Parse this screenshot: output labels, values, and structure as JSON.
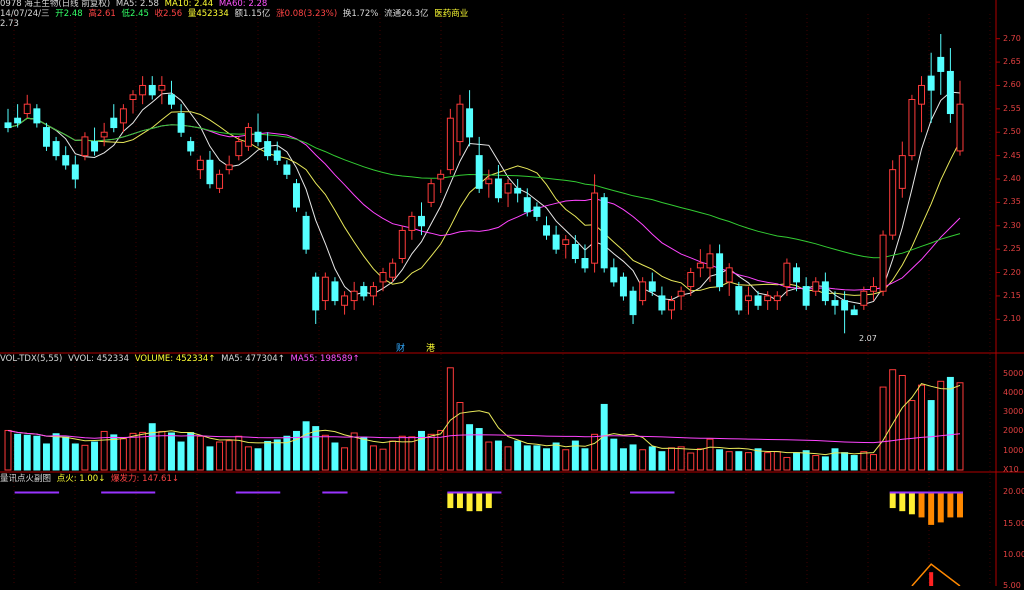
{
  "header": {
    "title": "0978 海王生物(日线 前复权)",
    "ma5": "MA5: 2.58",
    "ma10": "MA10: 2.44",
    "ma60": "MA60: 2.28",
    "date": "14/07/24/三",
    "open": "开2.48",
    "high": "高2.61",
    "low": "低2.45",
    "close": "收2.56",
    "volume": "量452334",
    "amount": "额1.15亿",
    "change": "涨0.08(3.23%)",
    "turnover": "换1.72%",
    "float": "流通26.3亿",
    "industry": "医药商业",
    "top_price": "2.73"
  },
  "panel_labels": {
    "vol": "VOL-TDX(5,55)",
    "vvol": "VVOL: 452334",
    "volume": "VOLUME: 452334↑",
    "ma5": "MA5: 477304↑",
    "ma55": "MA55: 198589↑",
    "ind_name": "量讯点火副图",
    "ind_a": "点火: 1.00↓",
    "ind_b": "爆发力: 147.61↓"
  },
  "markers": {
    "cai": "财",
    "gang": "港",
    "low": "2.07"
  },
  "colors": {
    "up": "#ff3b3b",
    "down": "#55ffff",
    "ma5": "#e8e8e8",
    "ma10": "#e8e85a",
    "ma20": "#ff44ff",
    "ma60": "#33cc33",
    "axis": "#b00000"
  },
  "chart_data": [
    {
      "type": "candlestick",
      "title": "price",
      "ylim": [
        2.06,
        2.74
      ],
      "y_ticks": [
        "2.70",
        "2.65",
        "2.60",
        "2.55",
        "2.50",
        "2.45",
        "2.40",
        "2.35",
        "2.30",
        "2.25",
        "2.20",
        "2.15",
        "2.10"
      ],
      "y_tick_values": [
        2.7,
        2.65,
        2.6,
        2.55,
        2.5,
        2.45,
        2.4,
        2.35,
        2.3,
        2.25,
        2.2,
        2.15,
        2.1
      ],
      "candles": [
        [
          2.52,
          2.55,
          2.5,
          2.51
        ],
        [
          2.53,
          2.56,
          2.51,
          2.52
        ],
        [
          2.54,
          2.58,
          2.53,
          2.56
        ],
        [
          2.55,
          2.56,
          2.51,
          2.52
        ],
        [
          2.51,
          2.52,
          2.46,
          2.47
        ],
        [
          2.48,
          2.49,
          2.44,
          2.45
        ],
        [
          2.45,
          2.47,
          2.42,
          2.43
        ],
        [
          2.43,
          2.45,
          2.38,
          2.4
        ],
        [
          2.45,
          2.5,
          2.44,
          2.49
        ],
        [
          2.48,
          2.51,
          2.45,
          2.46
        ],
        [
          2.49,
          2.52,
          2.47,
          2.5
        ],
        [
          2.53,
          2.56,
          2.5,
          2.51
        ],
        [
          2.52,
          2.56,
          2.5,
          2.55
        ],
        [
          2.57,
          2.59,
          2.54,
          2.58
        ],
        [
          2.58,
          2.62,
          2.56,
          2.6
        ],
        [
          2.6,
          2.62,
          2.57,
          2.58
        ],
        [
          2.59,
          2.62,
          2.56,
          2.6
        ],
        [
          2.58,
          2.61,
          2.55,
          2.56
        ],
        [
          2.54,
          2.56,
          2.49,
          2.5
        ],
        [
          2.48,
          2.49,
          2.45,
          2.46
        ],
        [
          2.42,
          2.45,
          2.4,
          2.44
        ],
        [
          2.44,
          2.46,
          2.38,
          2.39
        ],
        [
          2.38,
          2.42,
          2.37,
          2.41
        ],
        [
          2.42,
          2.45,
          2.41,
          2.43
        ],
        [
          2.45,
          2.49,
          2.44,
          2.48
        ],
        [
          2.47,
          2.52,
          2.46,
          2.51
        ],
        [
          2.5,
          2.54,
          2.47,
          2.48
        ],
        [
          2.48,
          2.5,
          2.44,
          2.45
        ],
        [
          2.46,
          2.48,
          2.43,
          2.44
        ],
        [
          2.43,
          2.44,
          2.4,
          2.41
        ],
        [
          2.39,
          2.4,
          2.33,
          2.34
        ],
        [
          2.32,
          2.33,
          2.24,
          2.25
        ],
        [
          2.19,
          2.2,
          2.09,
          2.12
        ],
        [
          2.14,
          2.2,
          2.12,
          2.19
        ],
        [
          2.18,
          2.19,
          2.13,
          2.14
        ],
        [
          2.13,
          2.16,
          2.11,
          2.15
        ],
        [
          2.14,
          2.18,
          2.12,
          2.16
        ],
        [
          2.17,
          2.18,
          2.14,
          2.15
        ],
        [
          2.15,
          2.18,
          2.13,
          2.17
        ],
        [
          2.18,
          2.21,
          2.16,
          2.2
        ],
        [
          2.19,
          2.23,
          2.18,
          2.22
        ],
        [
          2.23,
          2.3,
          2.22,
          2.29
        ],
        [
          2.29,
          2.33,
          2.27,
          2.32
        ],
        [
          2.32,
          2.35,
          2.28,
          2.3
        ],
        [
          2.35,
          2.4,
          2.34,
          2.39
        ],
        [
          2.4,
          2.42,
          2.37,
          2.41
        ],
        [
          2.42,
          2.55,
          2.41,
          2.53
        ],
        [
          2.48,
          2.58,
          2.45,
          2.56
        ],
        [
          2.55,
          2.59,
          2.47,
          2.49
        ],
        [
          2.45,
          2.49,
          2.37,
          2.38
        ],
        [
          2.39,
          2.42,
          2.36,
          2.4
        ],
        [
          2.4,
          2.43,
          2.35,
          2.36
        ],
        [
          2.37,
          2.4,
          2.34,
          2.39
        ],
        [
          2.38,
          2.4,
          2.35,
          2.37
        ],
        [
          2.36,
          2.38,
          2.32,
          2.33
        ],
        [
          2.34,
          2.35,
          2.31,
          2.32
        ],
        [
          2.3,
          2.32,
          2.27,
          2.28
        ],
        [
          2.28,
          2.3,
          2.24,
          2.25
        ],
        [
          2.26,
          2.28,
          2.23,
          2.27
        ],
        [
          2.26,
          2.28,
          2.22,
          2.23
        ],
        [
          2.23,
          2.26,
          2.2,
          2.21
        ],
        [
          2.22,
          2.41,
          2.2,
          2.37
        ],
        [
          2.36,
          2.37,
          2.2,
          2.21
        ],
        [
          2.21,
          2.23,
          2.17,
          2.18
        ],
        [
          2.19,
          2.2,
          2.14,
          2.15
        ],
        [
          2.16,
          2.17,
          2.09,
          2.11
        ],
        [
          2.14,
          2.19,
          2.13,
          2.18
        ],
        [
          2.18,
          2.2,
          2.15,
          2.16
        ],
        [
          2.15,
          2.17,
          2.11,
          2.12
        ],
        [
          2.12,
          2.15,
          2.1,
          2.14
        ],
        [
          2.15,
          2.17,
          2.12,
          2.16
        ],
        [
          2.17,
          2.21,
          2.15,
          2.2
        ],
        [
          2.21,
          2.25,
          2.19,
          2.22
        ],
        [
          2.21,
          2.26,
          2.18,
          2.24
        ],
        [
          2.24,
          2.26,
          2.16,
          2.17
        ],
        [
          2.18,
          2.22,
          2.15,
          2.21
        ],
        [
          2.17,
          2.18,
          2.11,
          2.12
        ],
        [
          2.14,
          2.17,
          2.11,
          2.15
        ],
        [
          2.15,
          2.16,
          2.12,
          2.13
        ],
        [
          2.14,
          2.16,
          2.12,
          2.15
        ],
        [
          2.14,
          2.16,
          2.12,
          2.15
        ],
        [
          2.17,
          2.23,
          2.15,
          2.22
        ],
        [
          2.21,
          2.22,
          2.16,
          2.18
        ],
        [
          2.17,
          2.19,
          2.12,
          2.13
        ],
        [
          2.16,
          2.19,
          2.15,
          2.18
        ],
        [
          2.18,
          2.2,
          2.13,
          2.14
        ],
        [
          2.14,
          2.16,
          2.11,
          2.13
        ],
        [
          2.14,
          2.16,
          2.07,
          2.12
        ],
        [
          2.12,
          2.13,
          2.11,
          2.11
        ],
        [
          2.13,
          2.17,
          2.12,
          2.16
        ],
        [
          2.16,
          2.19,
          2.14,
          2.17
        ],
        [
          2.16,
          2.29,
          2.15,
          2.28
        ],
        [
          2.28,
          2.44,
          2.27,
          2.42
        ],
        [
          2.38,
          2.48,
          2.36,
          2.45
        ],
        [
          2.45,
          2.58,
          2.44,
          2.57
        ],
        [
          2.56,
          2.62,
          2.5,
          2.6
        ],
        [
          2.62,
          2.67,
          2.52,
          2.59
        ],
        [
          2.66,
          2.71,
          2.58,
          2.63
        ],
        [
          2.63,
          2.68,
          2.52,
          2.54
        ],
        [
          2.46,
          2.61,
          2.45,
          2.56
        ]
      ],
      "ma_series": [
        {
          "name": "MA5",
          "color": "#e8e8e8"
        },
        {
          "name": "MA10",
          "color": "#e8e85a"
        },
        {
          "name": "MA20",
          "color": "#ff44ff"
        },
        {
          "name": "MA60",
          "color": "#33cc33"
        }
      ]
    },
    {
      "type": "bar",
      "title": "volume",
      "ylim": [
        0,
        56000
      ],
      "y_ticks": [
        "50000",
        "40000",
        "30000",
        "20000",
        "10000",
        "X10"
      ],
      "y_tick_values": [
        50000,
        40000,
        30000,
        20000,
        10000,
        0
      ],
      "volumes": [
        20500,
        18500,
        18000,
        17500,
        13500,
        18800,
        17000,
        13500,
        12800,
        14500,
        20000,
        18200,
        16200,
        19000,
        19500,
        24000,
        20000,
        19200,
        14500,
        19400,
        17500,
        12000,
        14500,
        15200,
        17500,
        12000,
        11000,
        14800,
        15600,
        17500,
        20000,
        25000,
        22500,
        18000,
        14000,
        11500,
        19200,
        17000,
        12500,
        10800,
        15000,
        17500,
        17200,
        20000,
        18500,
        20500,
        53000,
        35000,
        23500,
        21500,
        14500,
        15000,
        12000,
        15000,
        12500,
        12500,
        11000,
        14000,
        10500,
        15000,
        11000,
        18500,
        34000,
        16000,
        11000,
        13000,
        10500,
        12000,
        9500,
        11500,
        12000,
        8800,
        11000,
        16000,
        10500,
        9500,
        9500,
        9000,
        11000,
        9000,
        9500,
        6500,
        9000,
        10000,
        7500,
        6800,
        11000,
        9000,
        7500,
        9500,
        8000,
        43000,
        52000,
        49000,
        36000,
        44000,
        36000,
        46000,
        48000,
        45234
      ],
      "up_flags": [
        1,
        0,
        0,
        0,
        0,
        0,
        0,
        0,
        1,
        0,
        1,
        0,
        1,
        1,
        1,
        0,
        1,
        0,
        0,
        0,
        1,
        0,
        1,
        1,
        1,
        1,
        0,
        0,
        0,
        0,
        0,
        0,
        0,
        1,
        0,
        1,
        1,
        0,
        1,
        1,
        1,
        1,
        1,
        0,
        1,
        1,
        1,
        1,
        0,
        0,
        1,
        0,
        1,
        0,
        0,
        0,
        0,
        0,
        1,
        0,
        0,
        1,
        0,
        0,
        0,
        0,
        1,
        0,
        0,
        1,
        1,
        1,
        1,
        1,
        0,
        1,
        0,
        1,
        0,
        1,
        1,
        1,
        0,
        0,
        1,
        0,
        0,
        0,
        0,
        1,
        1,
        1,
        1,
        1,
        1,
        1,
        0,
        1,
        0,
        1
      ],
      "ma5_color": "#e8e85a",
      "ma55_color": "#ff44ff"
    },
    {
      "type": "bar",
      "title": "量讯点火副图",
      "ylim": [
        5,
        22
      ],
      "y_ticks": [
        "20.00",
        "15.00",
        "10.00",
        "5.00"
      ],
      "y_tick_values": [
        20,
        15,
        10,
        5
      ],
      "signal_bars": [
        {
          "i": 46,
          "v": 17.5
        },
        {
          "i": 47,
          "v": 17.5
        },
        {
          "i": 48,
          "v": 17.0
        },
        {
          "i": 49,
          "v": 17.0
        },
        {
          "i": 50,
          "v": 17.5
        },
        {
          "i": 92,
          "v": 17.5
        },
        {
          "i": 93,
          "v": 17.0
        },
        {
          "i": 94,
          "v": 16.5
        },
        {
          "i": 95,
          "v": 16.0
        },
        {
          "i": 96,
          "v": 14.8
        },
        {
          "i": 97,
          "v": 15.2
        },
        {
          "i": 98,
          "v": 16.0
        },
        {
          "i": 99,
          "v": 16.0
        }
      ],
      "spike_peak": 8.5
    }
  ]
}
